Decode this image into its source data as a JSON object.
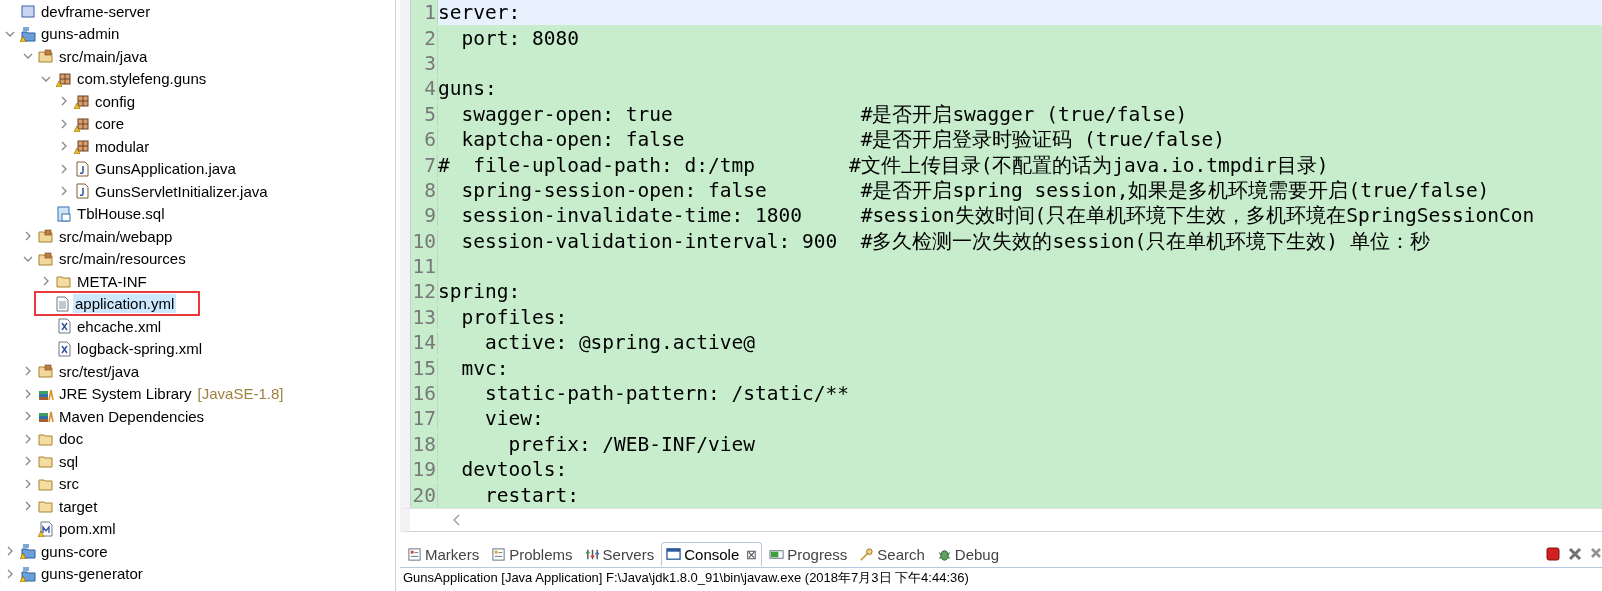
{
  "explorer": {
    "items": [
      {
        "label": "devframe-server",
        "kind": "server-project",
        "selected": false
      },
      {
        "label": "guns-admin",
        "kind": "project",
        "selected": false,
        "expanded": true,
        "children": [
          {
            "label": "src/main/java",
            "kind": "source-folder",
            "selected": false,
            "expanded": true,
            "children": [
              {
                "label": "com.stylefeng.guns",
                "kind": "package",
                "selected": false,
                "expanded": true,
                "children": [
                  {
                    "label": "config",
                    "kind": "package",
                    "selected": false,
                    "expanded": false
                  },
                  {
                    "label": "core",
                    "kind": "package",
                    "selected": false,
                    "expanded": false
                  },
                  {
                    "label": "modular",
                    "kind": "package",
                    "selected": false,
                    "expanded": false
                  },
                  {
                    "label": "GunsApplication.java",
                    "kind": "java",
                    "selected": false,
                    "expanded": false
                  },
                  {
                    "label": "GunsServletInitializer.java",
                    "kind": "java",
                    "selected": false,
                    "expanded": false
                  }
                ]
              },
              {
                "label": "TblHouse.sql",
                "kind": "sql",
                "selected": false
              }
            ]
          },
          {
            "label": "src/main/webapp",
            "kind": "source-folder",
            "selected": false,
            "expanded": false
          },
          {
            "label": "src/main/resources",
            "kind": "source-folder",
            "selected": false,
            "expanded": true,
            "children": [
              {
                "label": "META-INF",
                "kind": "folder",
                "selected": false,
                "expanded": false
              },
              {
                "label": "application.yml",
                "kind": "text",
                "selected": true
              },
              {
                "label": "ehcache.xml",
                "kind": "xml",
                "selected": false
              },
              {
                "label": "logback-spring.xml",
                "kind": "xml",
                "selected": false
              }
            ]
          },
          {
            "label": "src/test/java",
            "kind": "source-folder",
            "selected": false,
            "expanded": false
          },
          {
            "label": "JRE System Library",
            "decoration": "[JavaSE-1.8]",
            "kind": "library",
            "selected": false,
            "expanded": false
          },
          {
            "label": "Maven Dependencies",
            "kind": "library",
            "selected": false,
            "expanded": false
          },
          {
            "label": "doc",
            "kind": "folder",
            "selected": false,
            "expanded": false
          },
          {
            "label": "sql",
            "kind": "folder",
            "selected": false,
            "expanded": false
          },
          {
            "label": "src",
            "kind": "folder",
            "selected": false,
            "expanded": false
          },
          {
            "label": "target",
            "kind": "folder",
            "selected": false,
            "expanded": false
          },
          {
            "label": "pom.xml",
            "kind": "pom",
            "selected": false
          }
        ]
      },
      {
        "label": "guns-core",
        "kind": "project",
        "selected": false,
        "expanded": false
      },
      {
        "label": "guns-generator",
        "kind": "project",
        "selected": false,
        "expanded": false
      }
    ]
  },
  "editor": {
    "lines": [
      {
        "number": "1",
        "text": "server:",
        "current": true
      },
      {
        "number": "2",
        "text": "  port: 8080",
        "current": false
      },
      {
        "number": "3",
        "current": false
      },
      {
        "number": "4",
        "text": "guns:",
        "current": false
      },
      {
        "number": "5",
        "text": "  swagger-open: true                #是否开启swagger (true/false)",
        "current": false
      },
      {
        "number": "6",
        "text": "  kaptcha-open: false               #是否开启登录时验证码 (true/false)",
        "current": false
      },
      {
        "number": "7",
        "text": "#  file-upload-path: d:/tmp        #文件上传目录(不配置的话为java.io.tmpdir目录)",
        "current": false
      },
      {
        "number": "8",
        "text": "  spring-session-open: false        #是否开启spring session,如果是多机环境需要开启(true/false)",
        "current": false
      },
      {
        "number": "9",
        "text": "  session-invalidate-time: 1800     #session失效时间(只在单机环境下生效，多机环境在SpringSessionCon",
        "current": false
      },
      {
        "number": "10",
        "text": "  session-validation-interval: 900  #多久检测一次失效的session(只在单机环境下生效) 单位：秒",
        "current": false
      },
      {
        "number": "11",
        "current": false
      },
      {
        "number": "12",
        "text": "spring:",
        "current": false
      },
      {
        "number": "13",
        "text": "  profiles:",
        "current": false
      },
      {
        "number": "14",
        "text": "    active: @spring.active@",
        "current": false
      },
      {
        "number": "15",
        "text": "  mvc:",
        "current": false
      },
      {
        "number": "16",
        "text": "    static-path-pattern: /static/**",
        "current": false
      },
      {
        "number": "17",
        "text": "    view:",
        "current": false
      },
      {
        "number": "18",
        "text": "      prefix: /WEB-INF/view",
        "current": false
      },
      {
        "number": "19",
        "text": "  devtools:",
        "current": false
      },
      {
        "number": "20",
        "text": "    restart:",
        "current": false
      }
    ]
  },
  "bottom_panel": {
    "tabs": [
      {
        "label": "Markers",
        "kind": "markers",
        "selected": false
      },
      {
        "label": "Problems",
        "kind": "problems",
        "selected": false
      },
      {
        "label": "Servers",
        "kind": "servers",
        "selected": false
      },
      {
        "label": "Console",
        "kind": "console",
        "selected": true,
        "close": "⊠"
      },
      {
        "label": "Progress",
        "kind": "progress",
        "selected": false
      },
      {
        "label": "Search",
        "kind": "search",
        "selected": false
      },
      {
        "label": "Debug",
        "kind": "debug",
        "selected": false
      }
    ],
    "console_text": "GunsApplication [Java Application] F:\\Java\\jdk1.8.0_91\\bin\\javaw.exe (2018年7月3日 下午4:44:36)"
  }
}
